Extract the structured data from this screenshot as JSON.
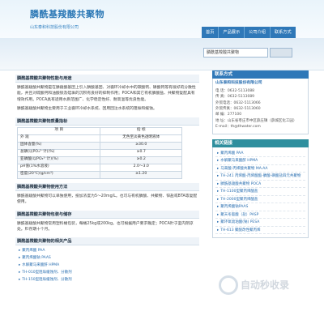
{
  "header": {
    "title": "膦酰基羧酸共聚物",
    "subtitle": "山东泰和科技股份有限公司",
    "nav": [
      "首页",
      "产品展示",
      "公司介绍",
      "联系方式"
    ]
  },
  "search": {
    "value": "膦酰基羧酸共聚物"
  },
  "main": {
    "sec1_title": "膦酰基羧酸共聚物性能与用途",
    "sec1_text": "膦酰基羧酸共聚物是在膦羧酸基团上引入膦酸基团、对循环冷却水中的碳酸钙、磷酸钙等有很好的分散性能，并且对硫酸钙和油酸钡及硅垢的沉积有良好的抑制作用；POCA和其它有机膦酸盐、共聚物复配具有增效作用。POCA具有适用水质范围广、化学稳定性好、耐高温等优良性能。",
    "sec1_text2": "膦酰基羧酸共聚物主要用于工业循环冷却水系统、回用回注水系统的阻垢和缓蚀。",
    "sec2_title": "膦酰基羧酸共聚物质量指标",
    "table": {
      "headers": [
        "项  目",
        "指  标"
      ],
      "rows": [
        [
          "外  观",
          "无色至淡黄色透明液体"
        ],
        [
          "固体含量(%)",
          "≥30.0"
        ],
        [
          "总磷(以PO₄³⁻计)(%)",
          "≥0.7"
        ],
        [
          "亚磷酸(以PO₃³⁻计)(%)",
          "≥0.2"
        ],
        [
          "pH值(1%水溶液)",
          "2.0～3.0"
        ],
        [
          "密度(20℃)(g/cm³)",
          "≥1.20"
        ]
      ]
    },
    "sec3_title": "膦酰基羧酸共聚物使用方法",
    "sec3_text": "膦酰基羧酸共聚物可以单独使用，投加浓度为5～20mg/L。也可与有机膦酸、共聚物、锌盐或BTA等复配使用。",
    "sec4_title": "膦酰基羧酸共聚物包装与储存",
    "sec4_text": "膦酰基羧酸共聚物常用塑料桶包装，每桶25kg或200kg。也可根据用户要求确定；POCA贮于室内阴凉处。贮存期十个月。",
    "sec5_title": "膦酰基羧酸共聚物的相关产品",
    "related": [
      "聚丙烯酸 PAA",
      "聚丙烯酸钠 PAAS",
      "水解聚马来酸酐 HPMA",
      "TH-010型阻垢缓蚀剂、分散剂",
      "TH-150型阻垢缓蚀剂、分散剂"
    ]
  },
  "side": {
    "contact_title": "联系方式",
    "company": "山东泰和科技股份有限公司",
    "lines": [
      "电    话：0632-5113088",
      "传    真：0632-5113089",
      "外贸电话：0632-5113066",
      "外贸传真：0632-5113060",
      "邮    编：277100",
      "地    址：山东省枣庄市中区薛庄镇（薛城区化工园）",
      "E-mail：th@thwater.com"
    ],
    "links_title": "相关链接",
    "links": [
      "聚丙烯酸 PAA",
      "水解聚马来酸酐 HPMA",
      "马来酸-丙烯酸共聚物 MA-AA",
      "TH-241 丙烯酸-丙烯酸酯-膦酸-磺酸盐四元共聚物",
      "膦酰基羧酸共聚物 POCA",
      "TH-1100型聚丙烯酸盐",
      "TH-2000型聚丙烯酸盐",
      "聚丙烯酸钠PAAS",
      "聚天冬氨酸（盐）PASP",
      "聚环氧琥珀酸(钠) PESA",
      "TH-613 聚醚改性聚丙烯"
    ]
  },
  "watermark": "自动秒收录"
}
